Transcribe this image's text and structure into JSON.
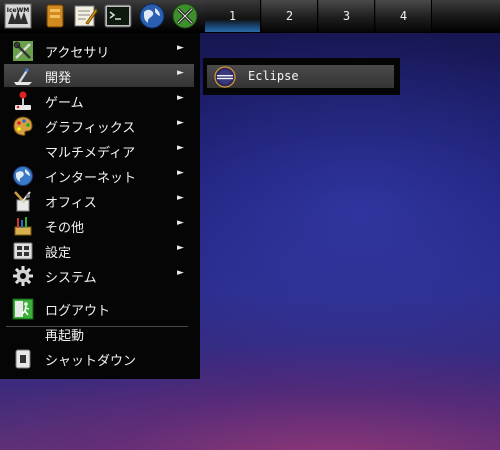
{
  "taskbar": {
    "launchers": [
      {
        "icon": "icewm-logo-icon"
      },
      {
        "icon": "file-manager-icon"
      },
      {
        "icon": "text-editor-icon"
      },
      {
        "icon": "terminal-icon"
      },
      {
        "icon": "web-browser-icon"
      },
      {
        "icon": "xfe-tools-icon"
      }
    ],
    "logo_text": "IceWM",
    "workspaces": [
      {
        "label": "1",
        "active": true
      },
      {
        "label": "2",
        "active": false
      },
      {
        "label": "3",
        "active": false
      },
      {
        "label": "4",
        "active": false
      }
    ]
  },
  "menu": {
    "items": [
      {
        "label": "アクセサリ",
        "icon": "accessories-icon",
        "submenu": true
      },
      {
        "label": "開発",
        "icon": "development-icon",
        "submenu": true,
        "highlighted": true
      },
      {
        "label": "ゲーム",
        "icon": "games-joystick-icon",
        "submenu": true
      },
      {
        "label": "グラフィックス",
        "icon": "graphics-palette-icon",
        "submenu": true
      },
      {
        "label": "マルチメディア",
        "icon": "",
        "submenu": true
      },
      {
        "label": "インターネット",
        "icon": "internet-globe-icon",
        "submenu": true
      },
      {
        "label": "オフィス",
        "icon": "office-icon",
        "submenu": true
      },
      {
        "label": "その他",
        "icon": "other-tools-icon",
        "submenu": true
      },
      {
        "label": "設定",
        "icon": "settings-icon",
        "submenu": true
      },
      {
        "label": "システム",
        "icon": "system-gear-icon",
        "submenu": true
      }
    ],
    "actions": [
      {
        "label": "ログアウト",
        "icon": "logout-icon"
      },
      {
        "label": "再起動",
        "icon": ""
      },
      {
        "label": "シャットダウン",
        "icon": "shutdown-icon"
      }
    ],
    "arrow_glyph": "►"
  },
  "submenu": {
    "items": [
      {
        "label": "Eclipse",
        "icon": "eclipse-icon"
      }
    ]
  },
  "colors": {
    "menu_bg": "#050505",
    "highlight": "#3e3e3e",
    "desktop_top": "#15154a",
    "desktop_bottom": "#5a3275",
    "active_workspace": "#2d6aa8"
  }
}
